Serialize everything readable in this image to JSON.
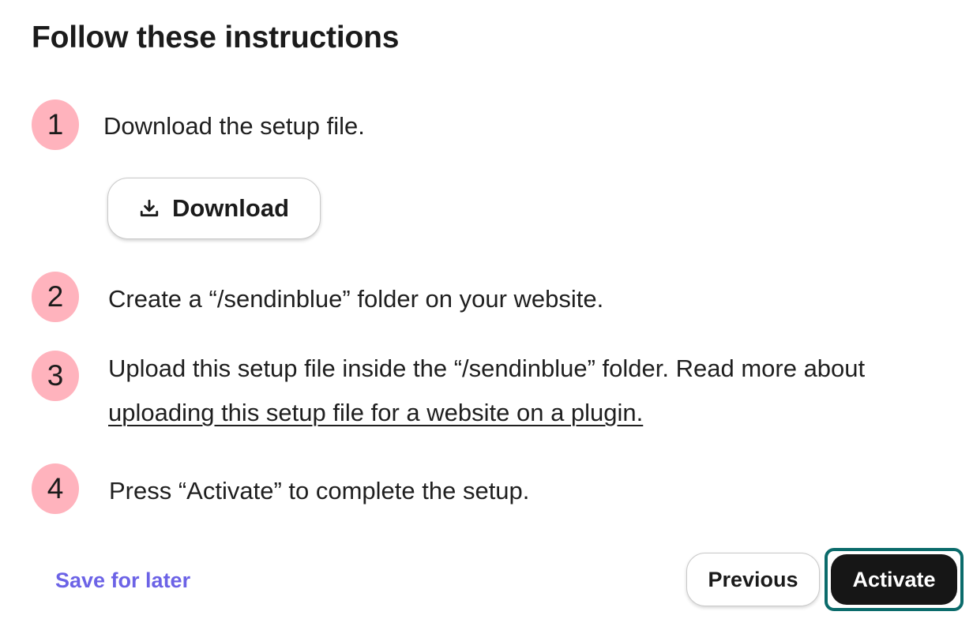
{
  "header": {
    "title": "Follow these instructions"
  },
  "steps": [
    {
      "number": "1",
      "text": "Download the setup file."
    },
    {
      "number": "2",
      "text": "Create a “/sendinblue” folder on your website."
    },
    {
      "number": "3",
      "text": "Upload this setup file inside the “/sendinblue” folder. Read more about",
      "link_text": "uploading this setup file for a website on a plugin."
    },
    {
      "number": "4",
      "text": "Press “Activate” to complete the setup."
    }
  ],
  "download_button": {
    "label": "Download",
    "icon": "download-icon"
  },
  "footer": {
    "save_for_later": "Save for later",
    "previous": "Previous",
    "activate": "Activate"
  },
  "colors": {
    "step_badge": "#ffb3bd",
    "link_accent": "#6c63e6",
    "primary_button": "#161616",
    "focus_ring": "#0b6b6b"
  }
}
